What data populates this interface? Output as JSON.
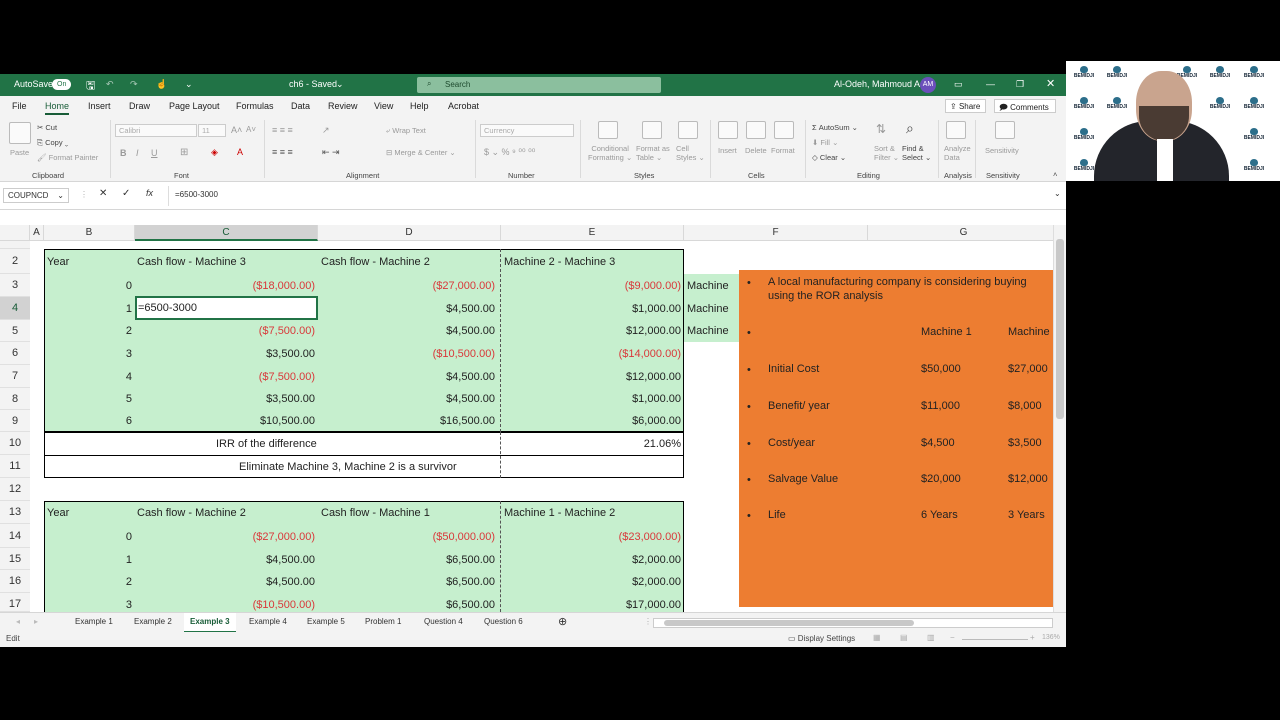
{
  "titlebar": {
    "autosave": "AutoSave",
    "toggle": "On",
    "file": "ch6 - Saved",
    "search": "Search",
    "user": "Al-Odeh, Mahmoud A",
    "initials": "AM"
  },
  "menu": [
    "File",
    "Home",
    "Insert",
    "Draw",
    "Page Layout",
    "Formulas",
    "Data",
    "Review",
    "View",
    "Help",
    "Acrobat"
  ],
  "share": "Share",
  "comments": "Comments",
  "ribbon": {
    "groups": [
      "Clipboard",
      "Font",
      "Alignment",
      "Number",
      "Styles",
      "Cells",
      "Editing",
      "Analysis",
      "Sensitivity"
    ],
    "paste": "Paste",
    "cut": "Cut",
    "copy": "Copy",
    "format_painter": "Format Painter",
    "font": "Calibri",
    "size": "11",
    "wrap": "Wrap Text",
    "merge": "Merge & Center",
    "numfmt": "Currency",
    "cond1": "Conditional",
    "cond2": "Formatting",
    "ftable1": "Format as",
    "ftable2": "Table",
    "cell1": "Cell",
    "cell2": "Styles",
    "insert": "Insert",
    "delete": "Delete",
    "format": "Format",
    "autosum": "AutoSum",
    "fill": "Fill",
    "clear": "Clear",
    "sort1": "Sort &",
    "sort2": "Filter",
    "find1": "Find &",
    "find2": "Select",
    "analyze1": "Analyze",
    "analyze2": "Data",
    "sensitivity": "Sensitivity"
  },
  "namebox": "COUPNCD",
  "formula": "=6500-3000",
  "columns": [
    "A",
    "B",
    "C",
    "D",
    "E",
    "F",
    "G"
  ],
  "rows": [
    "2",
    "3",
    "4",
    "5",
    "6",
    "7",
    "8",
    "9",
    "10",
    "11",
    "12",
    "13",
    "14",
    "15",
    "16",
    "17"
  ],
  "table1": {
    "headers": [
      "Year",
      "Cash flow - Machine 3",
      "Cash flow - Machine 2",
      "Machine 2 - Machine 3"
    ],
    "years": [
      "0",
      "1",
      "2",
      "3",
      "4",
      "5",
      "6"
    ],
    "c": [
      "($18,000.00)",
      "=6500-3000",
      "($7,500.00)",
      "$3,500.00",
      "($7,500.00)",
      "$3,500.00",
      "$10,500.00"
    ],
    "d": [
      "($27,000.00)",
      "$4,500.00",
      "$4,500.00",
      "($10,500.00)",
      "$4,500.00",
      "$4,500.00",
      "$16,500.00"
    ],
    "e": [
      "($9,000.00)",
      "$1,000.00",
      "$12,000.00",
      "($14,000.00)",
      "$12,000.00",
      "$1,000.00",
      "$6,000.00"
    ],
    "irr_label": "IRR of the difference",
    "irr_value": "21.06%",
    "conclusion": "Eliminate Machine 3, Machine 2 is a survivor"
  },
  "f_partial": [
    "Machine",
    "Machine",
    "Machine"
  ],
  "table2": {
    "headers": [
      "Year",
      "Cash flow - Machine 2",
      "Cash flow - Machine 1",
      "Machine 1 - Machine 2"
    ],
    "years": [
      "0",
      "1",
      "2",
      "3"
    ],
    "c": [
      "($27,000.00)",
      "$4,500.00",
      "$4,500.00",
      "($10,500.00)"
    ],
    "d": [
      "($50,000.00)",
      "$6,500.00",
      "$6,500.00",
      "$6,500.00"
    ],
    "e": [
      "($23,000.00)",
      "$2,000.00",
      "$2,000.00",
      "$17,000.00"
    ]
  },
  "problem": {
    "intro1": "A local manufacturing company is considering buying",
    "intro2": "using the ROR analysis",
    "col1": "Machine 1",
    "col2": "Machine",
    "rows": [
      {
        "label": "Initial Cost",
        "m1": "$50,000",
        "m2": "$27,000"
      },
      {
        "label": "Benefit/ year",
        "m1": "$11,000",
        "m2": "$8,000"
      },
      {
        "label": "Cost/year",
        "m1": "$4,500",
        "m2": "$3,500"
      },
      {
        "label": "Salvage Value",
        "m1": "$20,000",
        "m2": "$12,000"
      },
      {
        "label": "Life",
        "m1": "6 Years",
        "m2": "3 Years"
      }
    ],
    "bullet": "•"
  },
  "sheets": [
    "Example 1",
    "Example 2",
    "Example 3",
    "Example 4",
    "Example 5",
    "Problem 1",
    "Question 4",
    "Question 6"
  ],
  "active_sheet": "Example 3",
  "status": {
    "mode": "Edit",
    "display": "Display Settings",
    "zoom": "136%"
  },
  "video": {
    "logo": "BEMIDJI"
  }
}
